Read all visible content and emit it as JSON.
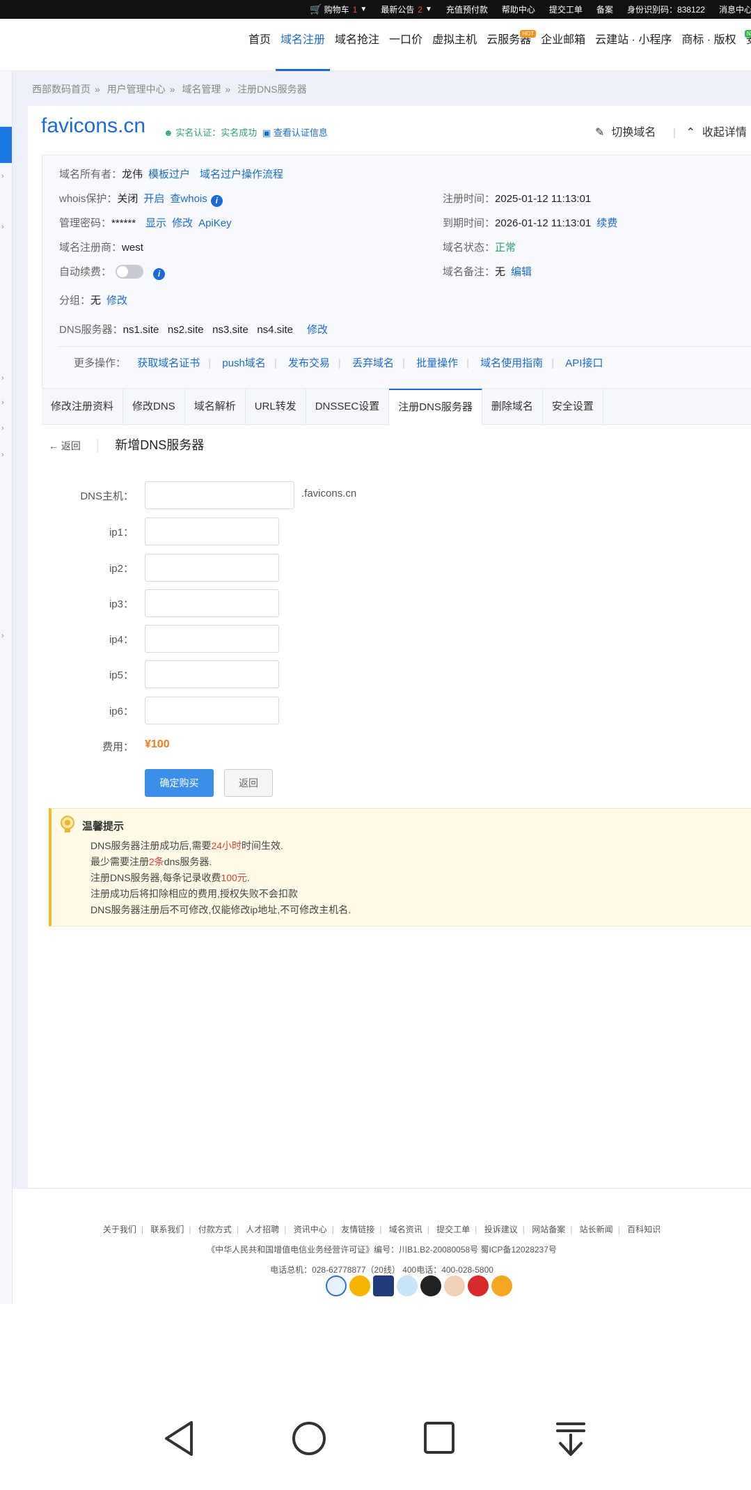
{
  "topbar": {
    "cart": "购物车",
    "cart_count": "1",
    "notice": "最新公告",
    "notice_count": "2",
    "items": [
      "充值预付款",
      "帮助中心",
      "提交工单",
      "备案"
    ],
    "id_code": "身份识别码：838122",
    "messages": "消息中心"
  },
  "nav": {
    "items": [
      {
        "label": "首页"
      },
      {
        "label": "域名注册"
      },
      {
        "label": "域名抢注"
      },
      {
        "label": "一口价"
      },
      {
        "label": "虚拟主机"
      },
      {
        "label": "云服务器",
        "badge": "HOT"
      },
      {
        "label": "企业邮箱"
      },
      {
        "label": "云建站 · 小程序"
      },
      {
        "label": "商标 · 版权"
      },
      {
        "label": "安",
        "badge": "NEW"
      }
    ]
  },
  "breadcrumb": [
    "西部数码首页",
    "用户管理中心",
    "域名管理",
    "注册DNS服务器"
  ],
  "domain": {
    "name": "favicons.cn",
    "auth_status": "实名认证：实名成功",
    "auth_link": "查看认证信息",
    "switch": "切换域名",
    "collapse": "收起详情"
  },
  "info": {
    "owner_label": "域名所有者：",
    "owner": "龙伟",
    "owner_link1": "模板过户",
    "owner_link2": "域名过户操作流程",
    "whois_label": "whois保护：",
    "whois": "关闭",
    "whois_on": "开启",
    "whois_check": "查whois",
    "pwd_label": "管理密码：",
    "pwd": "******",
    "pwd_show": "显示",
    "pwd_edit": "修改",
    "apikey": "ApiKey",
    "registrar_label": "域名注册商：",
    "registrar": "west",
    "autorenew_label": "自动续费：",
    "group_label": "分组：",
    "group": "无",
    "group_edit": "修改",
    "dns_label": "DNS服务器：",
    "dns": [
      "ns1.site",
      "ns2.site",
      "ns3.site",
      "ns4.site"
    ],
    "dns_edit": "修改",
    "reg_time_label": "注册时间：",
    "reg_time": "2025-01-12 11:13:01",
    "exp_time_label": "到期时间：",
    "exp_time": "2026-01-12 11:13:01",
    "renew": "续费",
    "status_label": "域名状态：",
    "status": "正常",
    "beian_label": "域名备注：",
    "beian": "无",
    "beian_edit": "编辑",
    "more_label": "更多操作：",
    "more": [
      "获取域名证书",
      "push域名",
      "发布交易",
      "丢弃域名",
      "批量操作",
      "域名使用指南",
      "API接口"
    ]
  },
  "tabs": [
    "修改注册资料",
    "修改DNS",
    "域名解析",
    "URL转发",
    "DNSSEC设置",
    "注册DNS服务器",
    "删除域名",
    "安全设置"
  ],
  "form": {
    "back": "返回",
    "title": "新增DNS服务器",
    "host_label": "DNS主机：",
    "suffix": ".favicons.cn",
    "ip_labels": [
      "ip1：",
      "ip2：",
      "ip3：",
      "ip4：",
      "ip5：",
      "ip6："
    ],
    "fee_label": "费用：",
    "fee": "¥100",
    "submit": "确定购买",
    "cancel": "返回"
  },
  "tips": {
    "title": "温馨提示",
    "l1a": "DNS服务器注册成功后,需要",
    "l1b": "24小时",
    "l1c": "时间生效.",
    "l2a": "最少需要注册",
    "l2b": "2条",
    "l2c": "dns服务器.",
    "l3a": "注册DNS服务器,每条记录收费",
    "l3b": "100元",
    "l3c": ".",
    "l4": "注册成功后将扣除相应的费用,授权失败不会扣款",
    "l5": "DNS服务器注册后不可修改,仅能修改ip地址,不可修改主机名."
  },
  "footer": {
    "links": [
      "关于我们",
      "联系我们",
      "付款方式",
      "人才招聘",
      "资讯中心",
      "友情链接",
      "域名资讯",
      "提交工单",
      "投诉建议",
      "网站备案",
      "站长新闻",
      "百科知识"
    ],
    "license": "《中华人民共和国增值电信业务经营许可证》编号：川B1.B2-20080058号  蜀ICP备12028237号",
    "phone": "电话总机：028-62778877（20线）      400电话：400-028-5800"
  }
}
